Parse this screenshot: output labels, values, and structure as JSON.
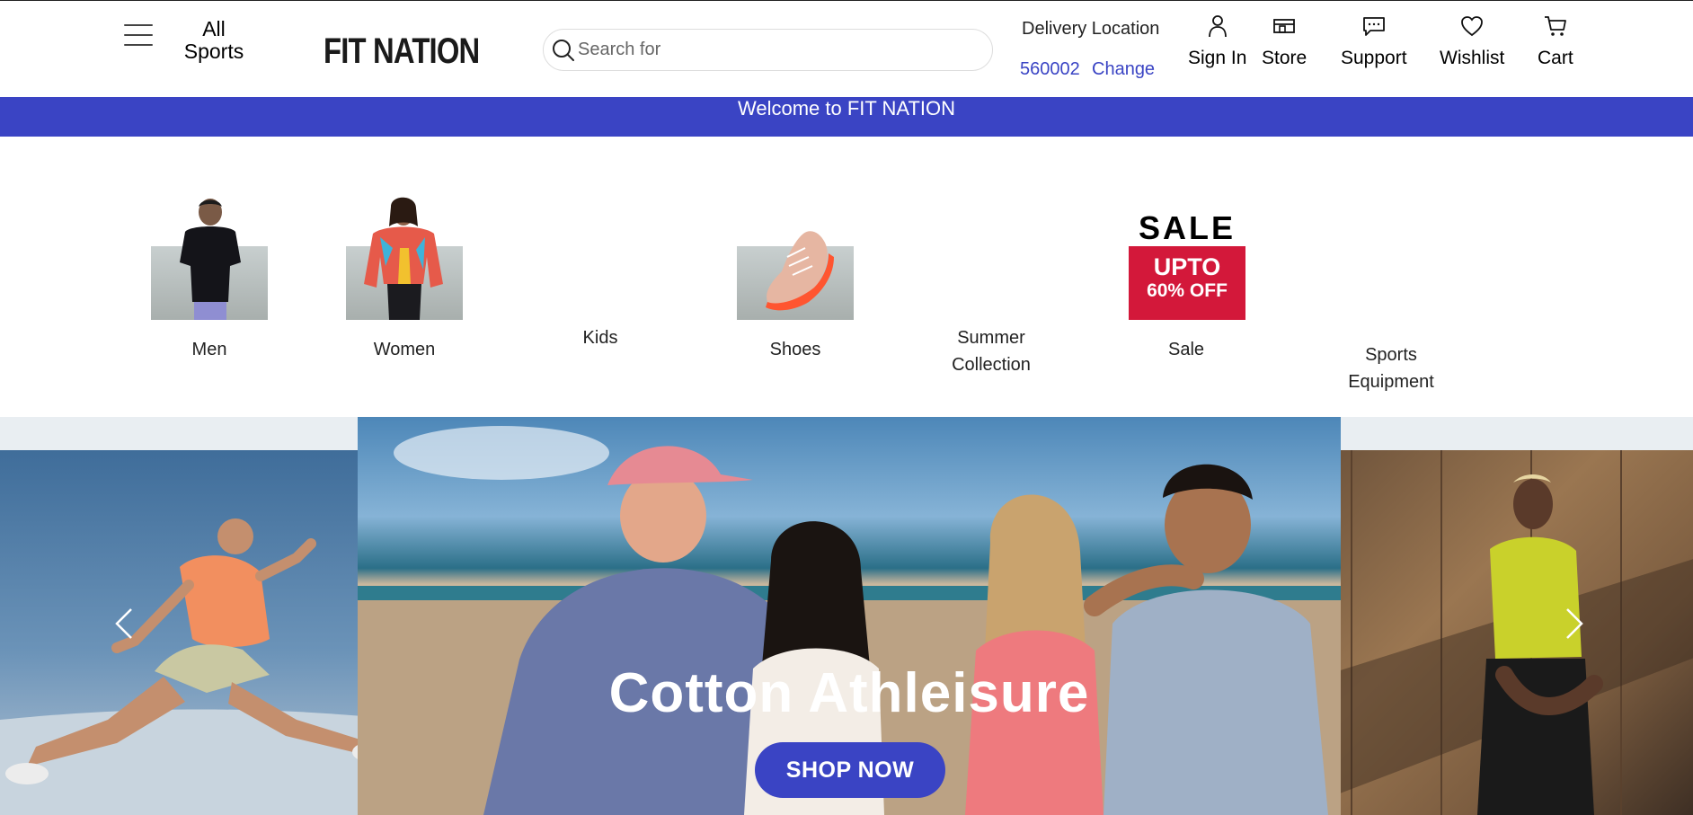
{
  "header": {
    "all_sports": "All Sports",
    "logo_text": "FIT NATION",
    "search_placeholder": "Search for",
    "delivery_label": "Delivery Location",
    "pincode": "560002",
    "change_label": "Change",
    "nav": [
      {
        "label": "Sign In",
        "icon": "user-icon"
      },
      {
        "label": "Store",
        "icon": "store-icon"
      },
      {
        "label": "Support",
        "icon": "chat-icon"
      },
      {
        "label": "Wishlist",
        "icon": "heart-icon"
      },
      {
        "label": "Cart",
        "icon": "cart-icon"
      }
    ]
  },
  "welcome_text": "Welcome to FIT NATION",
  "categories": [
    {
      "label": "Men"
    },
    {
      "label": "Women"
    },
    {
      "label": "Kids"
    },
    {
      "label": "Shoes"
    },
    {
      "label": "Summer Collection"
    },
    {
      "label": "Sale",
      "promo_top": "SALE",
      "promo_mid": "UPTO",
      "promo_bottom": "60% OFF"
    },
    {
      "label": "Sports Equipment"
    }
  ],
  "hero": {
    "title": "Cotton Athleisure",
    "cta": "SHOP NOW"
  },
  "colors": {
    "brand_blue": "#3a44c4",
    "logo_red": "#c8232c",
    "sale_red": "#d3183a"
  }
}
